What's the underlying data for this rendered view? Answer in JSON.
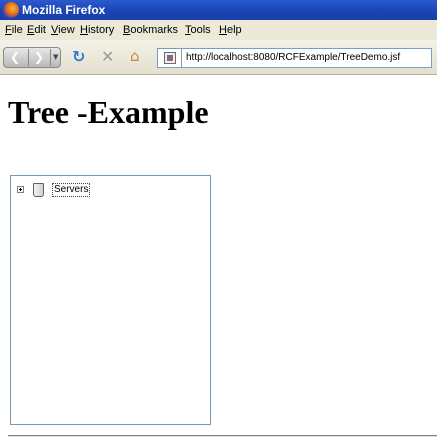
{
  "window": {
    "title": "Mozilla Firefox"
  },
  "menu": [
    {
      "label": "File"
    },
    {
      "label": "Edit"
    },
    {
      "label": "View"
    },
    {
      "label": "History"
    },
    {
      "label": "Bookmarks"
    },
    {
      "label": "Tools"
    },
    {
      "label": "Help"
    }
  ],
  "navbar": {
    "url": "http://localhost:8080/RCFExample/TreeDemo.jsf",
    "icons": [
      "back-icon",
      "forward-icon",
      "reload-icon",
      "stop-icon",
      "home-icon",
      "site-icon"
    ]
  },
  "page": {
    "heading": "Tree -Example",
    "tree": {
      "nodes": [
        {
          "label": "Servers",
          "expanded": false
        }
      ]
    }
  },
  "colors": {
    "titlebar": "#1a46b8",
    "menubar": "#ece9d8",
    "reload": "#2a78d8",
    "stop": "#9a9a9a",
    "tree_border": "#7a98b0"
  }
}
